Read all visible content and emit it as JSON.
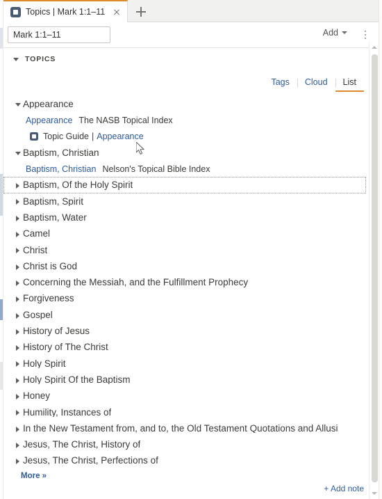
{
  "window": {
    "tab": {
      "icon": "logos-app-icon",
      "title": "Topics | Mark 1:1–11",
      "close_label": "×",
      "new_tab_label": "+"
    }
  },
  "toolbar": {
    "reference_value": "Mark 1:1–11",
    "reference_placeholder": "Mark 1:1–11",
    "add_label": "Add",
    "menu_label": "⋮"
  },
  "section": {
    "label": "TOPICS",
    "expanded": true
  },
  "view_tabs": [
    {
      "label": "Tags",
      "active": false
    },
    {
      "label": "Cloud",
      "active": false
    },
    {
      "label": "List",
      "active": true
    }
  ],
  "tree": [
    {
      "label": "Appearance",
      "state": "open",
      "focused": false,
      "children": [
        {
          "type": "link-source",
          "link": "Appearance",
          "source": "The NASB Topical Index"
        },
        {
          "type": "guide",
          "prefix": "Topic Guide",
          "separator": "|",
          "link": "Appearance"
        }
      ]
    },
    {
      "label": "Baptism, Christian",
      "state": "open",
      "focused": false,
      "children": [
        {
          "type": "link-source",
          "link": "Baptism, Christian",
          "source": "Nelson's Topical Bible Index"
        }
      ]
    },
    {
      "label": "Baptism, Of the Holy Spirit",
      "state": "closed",
      "focused": true,
      "children": []
    },
    {
      "label": "Baptism, Spirit",
      "state": "closed",
      "focused": false,
      "children": []
    },
    {
      "label": "Baptism, Water",
      "state": "closed",
      "focused": false,
      "children": []
    },
    {
      "label": "Camel",
      "state": "closed",
      "focused": false,
      "children": []
    },
    {
      "label": "Christ",
      "state": "closed",
      "focused": false,
      "children": []
    },
    {
      "label": "Christ is God",
      "state": "closed",
      "focused": false,
      "children": []
    },
    {
      "label": "Concerning the Messiah, and the Fulfillment Prophecy",
      "state": "closed",
      "focused": false,
      "children": []
    },
    {
      "label": "Forgiveness",
      "state": "closed",
      "focused": false,
      "children": []
    },
    {
      "label": "Gospel",
      "state": "closed",
      "focused": false,
      "children": []
    },
    {
      "label": "History of Jesus",
      "state": "closed",
      "focused": false,
      "children": []
    },
    {
      "label": "History of The Christ",
      "state": "closed",
      "focused": false,
      "children": []
    },
    {
      "label": "Holy Spirit",
      "state": "closed",
      "focused": false,
      "children": []
    },
    {
      "label": "Holy Spirit Of the Baptism",
      "state": "closed",
      "focused": false,
      "children": []
    },
    {
      "label": "Honey",
      "state": "closed",
      "focused": false,
      "children": []
    },
    {
      "label": "Humility, Instances of",
      "state": "closed",
      "focused": false,
      "children": []
    },
    {
      "label": "In the New Testament from, and to, the Old Testament Quotations and Allusi",
      "state": "closed",
      "focused": false,
      "children": []
    },
    {
      "label": "Jesus, The Christ, History of",
      "state": "closed",
      "focused": false,
      "children": []
    },
    {
      "label": "Jesus, The Christ, Perfections of",
      "state": "closed",
      "focused": false,
      "children": []
    }
  ],
  "more": {
    "label": "More »"
  },
  "bottom": {
    "add_note_label": "+ Add note"
  },
  "colors": {
    "link": "#2f5b9c",
    "text": "#3c3a37",
    "accent_orange": "#e08a2e",
    "tabbar_bg": "#f1f1f0",
    "icon_blue": "#4a5a74"
  }
}
